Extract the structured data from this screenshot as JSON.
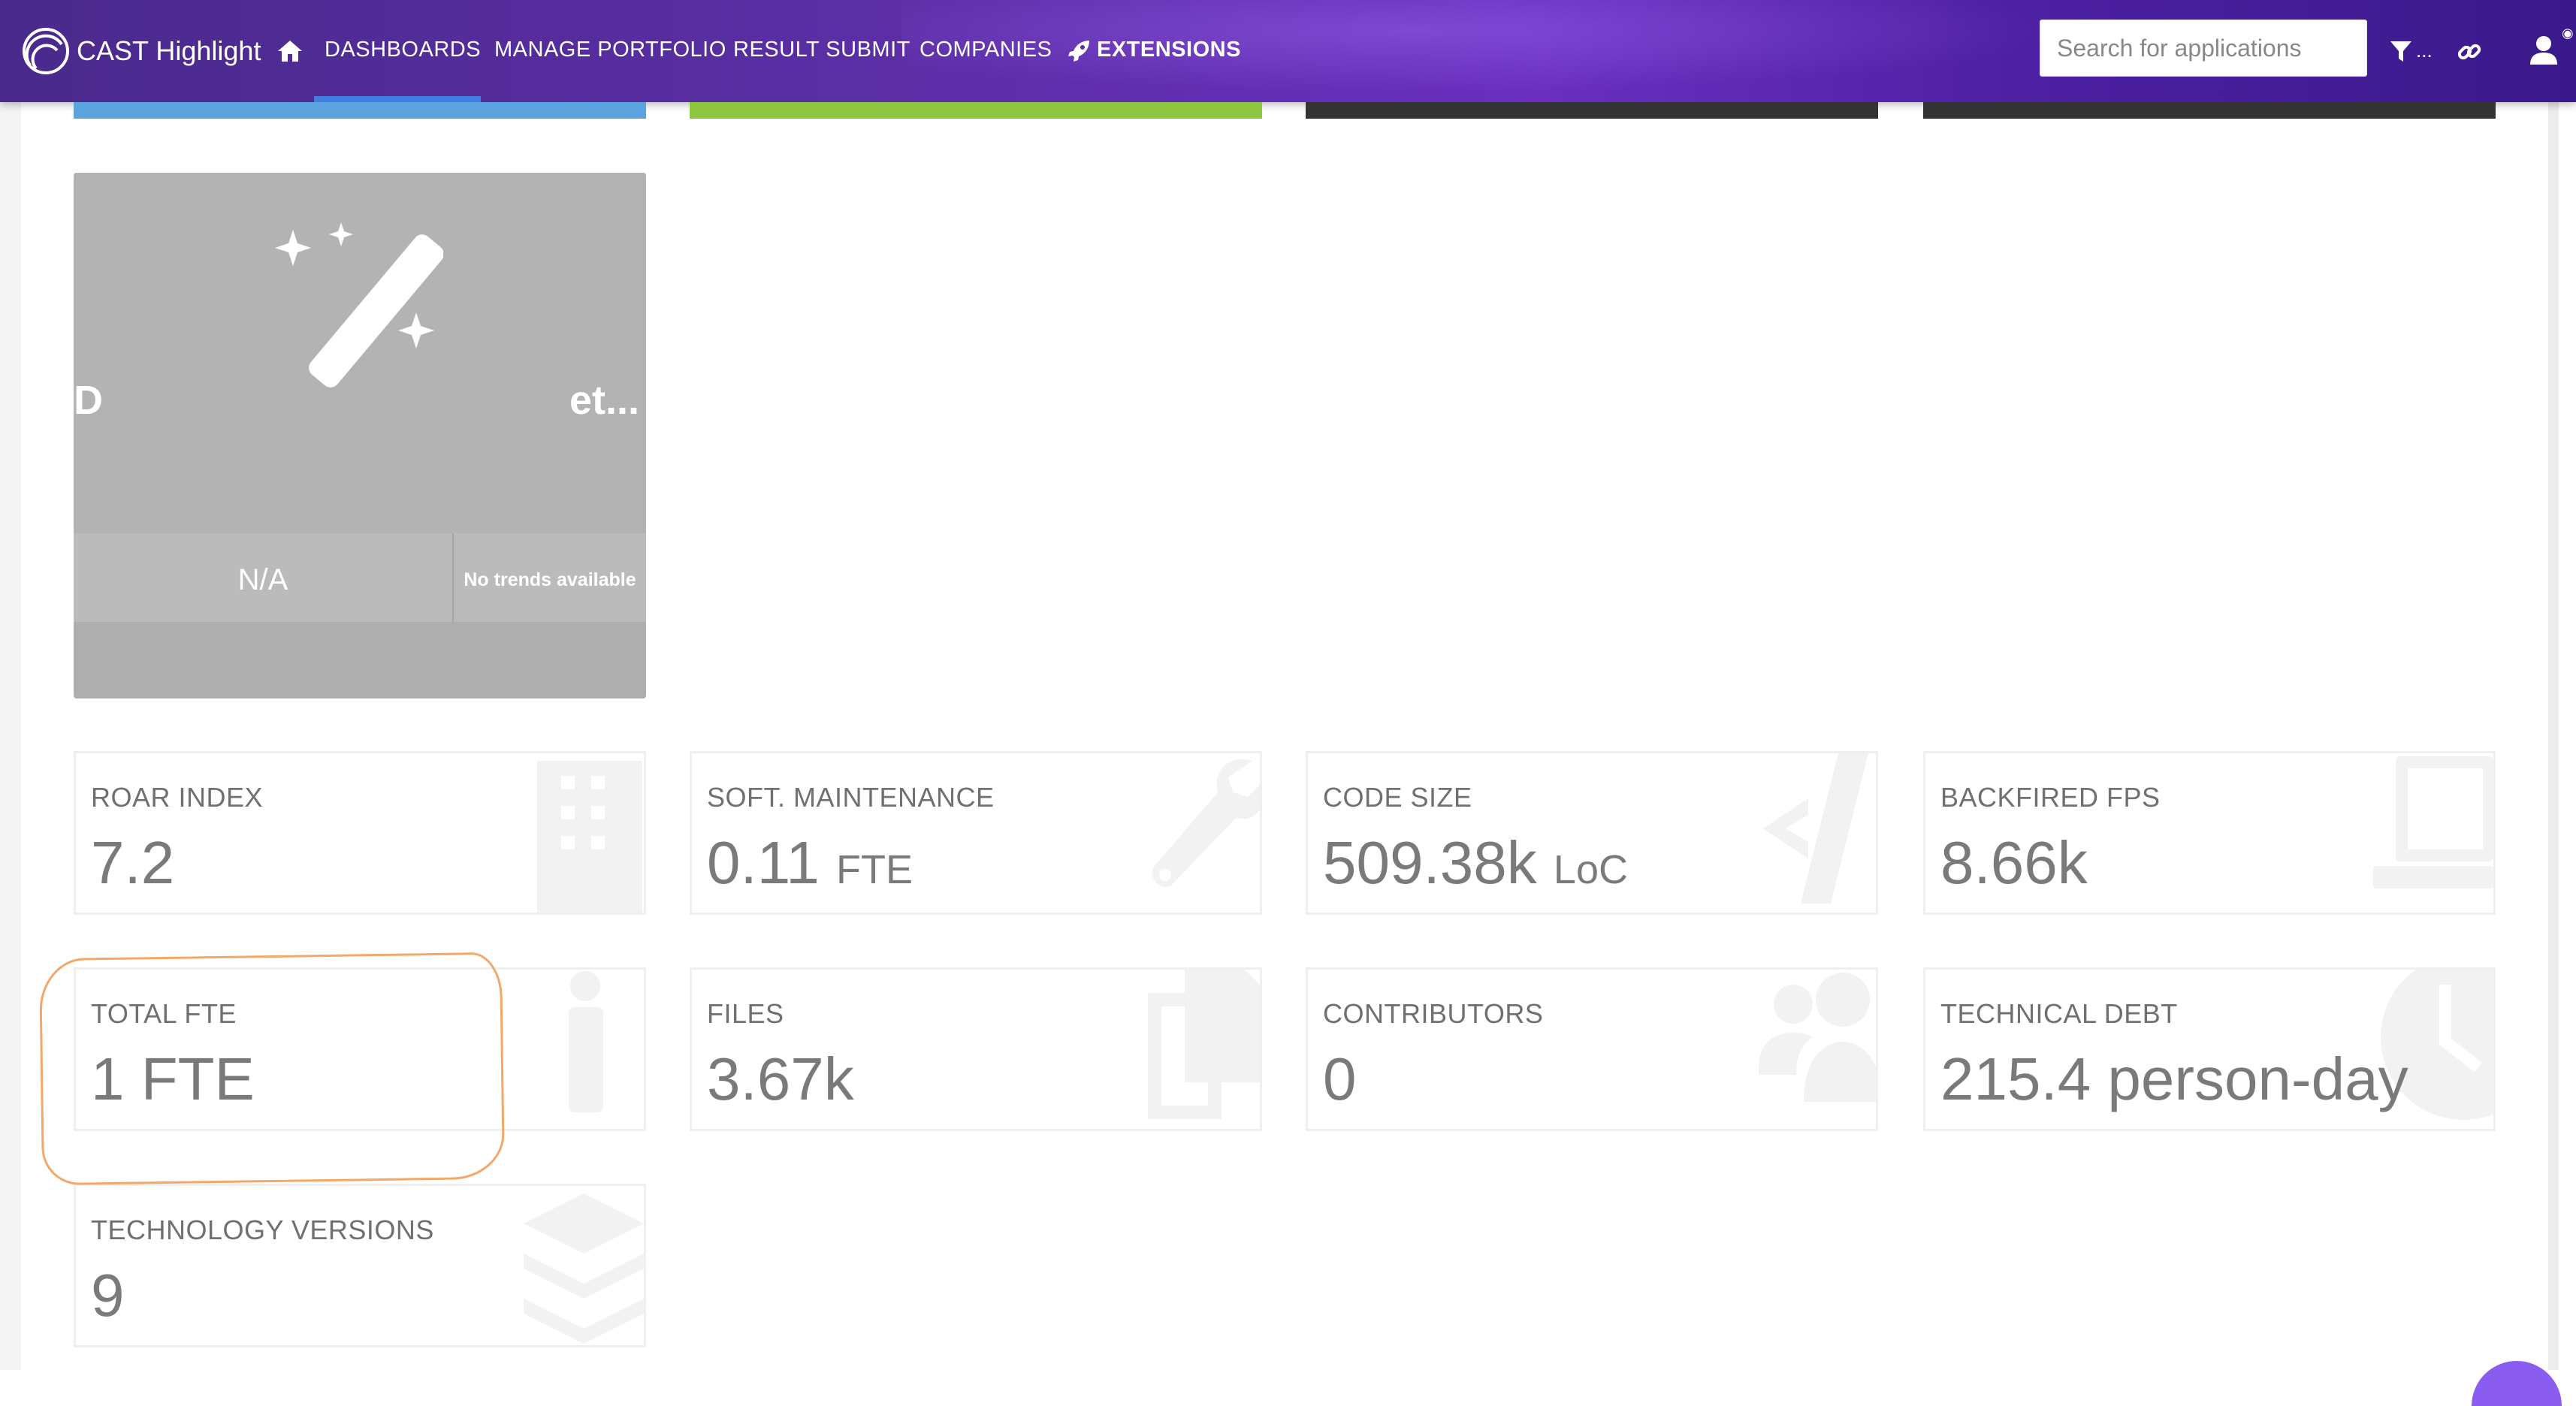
{
  "app": {
    "brand": "CAST Highlight"
  },
  "nav": {
    "items": [
      "DASHBOARDS",
      "MANAGE PORTFOLIO",
      "RESULT SUBMIT",
      "COMPANIES",
      "EXTENSIONS"
    ],
    "active": "DASHBOARDS",
    "filter_suffix": "..."
  },
  "search": {
    "placeholder": "Search for applications"
  },
  "colors": {
    "nav_bg": "#5b2ea6",
    "strip_blue": "#5aa3de",
    "strip_green": "#8cc63f",
    "strip_dark": "#333333",
    "annotation": "#f3a868"
  },
  "wizard_card": {
    "title_left": "D",
    "title_right": "et...",
    "value": "N/A",
    "trend": "No trends available",
    "icon": "magic-wand-icon"
  },
  "tiles": [
    {
      "label": "ROAR INDEX",
      "value": "7.2",
      "unit": "",
      "icon": "building-icon"
    },
    {
      "label": "SOFT. MAINTENANCE",
      "value": "0.11",
      "unit": "FTE",
      "icon": "wrench-icon"
    },
    {
      "label": "CODE SIZE",
      "value": "509.38k",
      "unit": "LoC",
      "icon": "code-icon"
    },
    {
      "label": "BACKFIRED FPS",
      "value": "8.66k",
      "unit": "",
      "icon": "computer-icon"
    },
    {
      "label": "TOTAL FTE",
      "value": "1 FTE",
      "unit": "",
      "icon": "person-icon"
    },
    {
      "label": "FILES",
      "value": "3.67k",
      "unit": "",
      "icon": "files-icon"
    },
    {
      "label": "CONTRIBUTORS",
      "value": "0",
      "unit": "",
      "icon": "users-icon"
    },
    {
      "label": "TECHNICAL DEBT",
      "value": "215.4 person-day",
      "unit": "",
      "icon": "clock-icon"
    },
    {
      "label": "TECHNOLOGY VERSIONS",
      "value": "9",
      "unit": "",
      "icon": "layers-icon"
    }
  ]
}
